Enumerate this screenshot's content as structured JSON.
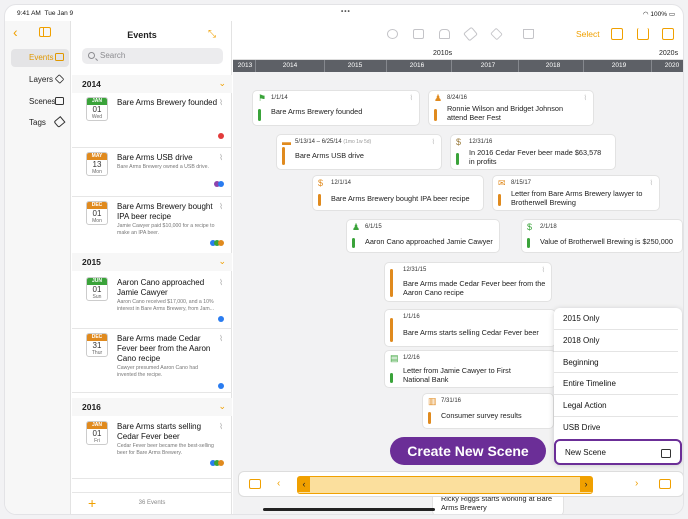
{
  "status": {
    "time": "9:41 AM",
    "date": "Tue Jan 9",
    "dots": "•••",
    "battery": "100%"
  },
  "nav": {
    "items": [
      {
        "label": "Events",
        "icon": "calendar-icon",
        "active": true
      },
      {
        "label": "Layers",
        "icon": "layers-icon"
      },
      {
        "label": "Scenes",
        "icon": "scenes-icon"
      },
      {
        "label": "Tags",
        "icon": "tag-icon"
      }
    ]
  },
  "list": {
    "title": "Events",
    "search_placeholder": "Search",
    "footer_count": "36 Events",
    "years": [
      "2014",
      "2015",
      "2016"
    ],
    "events": [
      {
        "month": "JAN",
        "day": "01",
        "weekday": "Wed",
        "month_color": "#3aa33a",
        "title": "Bare Arms Brewery founded",
        "desc": "",
        "dots": [
          "#e23b3b"
        ]
      },
      {
        "month": "MAY",
        "day": "13",
        "weekday": "Mon",
        "month_color": "#e08a1e",
        "title": "Bare Arms USB drive",
        "desc": "Bare Arms Brewery owned a USB drive.",
        "dots": [
          "#8e44ad",
          "#2a7cf0"
        ]
      },
      {
        "month": "DEC",
        "day": "01",
        "weekday": "Mon",
        "month_color": "#e08a1e",
        "title": "Bare Arms Brewery bought IPA beer recipe",
        "desc": "Jamie Cawyer paid $10,000 for a recipe to make an IPA beer.",
        "dots": [
          "#2a7cf0",
          "#3aa33a",
          "#e08a1e"
        ]
      },
      {
        "month": "JUN",
        "day": "01",
        "weekday": "Sun",
        "month_color": "#3aa33a",
        "title": "Aaron Cano approached Jamie Cawyer",
        "desc": "Aaron Cano received $17,000, and a 10% interest in Bare Arms Brewery, from Jam...",
        "dots": [
          "#2a7cf0"
        ]
      },
      {
        "month": "DEC",
        "day": "31",
        "weekday": "Thur",
        "month_color": "#e08a1e",
        "title": "Bare Arms made Cedar Fever beer from the Aaron Cano recipe",
        "desc": "Cawyer presumed Aaron Cano had invented the recipe.",
        "dots": [
          "#2a7cf0"
        ]
      },
      {
        "month": "JAN",
        "day": "01",
        "weekday": "Fri",
        "month_color": "#e08a1e",
        "title": "Bare Arms starts selling Cedar Fever beer",
        "desc": "Cedar Fever beer became the best-selling beer for Bare Arms Brewery.",
        "dots": [
          "#2a7cf0",
          "#3aa33a",
          "#e08a1e"
        ]
      }
    ]
  },
  "toolbar": {
    "select_label": "Select"
  },
  "ruler": {
    "decade_1": "2010s",
    "decade_2": "2020s",
    "years": [
      "2013",
      "2014",
      "2015",
      "2016",
      "2017",
      "2018",
      "2019",
      "2020"
    ]
  },
  "cards": [
    {
      "date": "1/1/14",
      "title": "Bare Arms Brewery founded",
      "title2": "",
      "icon": "flag-icon",
      "icon_glyph": "⚑",
      "color": "#3aa33a"
    },
    {
      "date": "8/24/16",
      "title": "Ronnie Wilson and Bridget Johnson",
      "title2": "attend Beer Fest",
      "icon": "person-icon",
      "icon_glyph": "♟",
      "color": "#e08a1e"
    },
    {
      "date": "5/13/14 – 6/25/14",
      "date_extra": "(1mo 1w 5d)",
      "title": "Bare Arms USB drive",
      "title2": "",
      "icon": "usb-icon",
      "icon_glyph": "▬",
      "color": "#e08a1e"
    },
    {
      "date": "12/31/16",
      "title": "In 2016 Cedar Fever beer made $63,578",
      "title2": "in profits",
      "icon": "money-bag-icon",
      "icon_glyph": "$",
      "color": "#3aa33a"
    },
    {
      "date": "12/1/14",
      "title": "Bare Arms Brewery bought IPA beer recipe",
      "title2": "",
      "icon": "dollar-icon",
      "icon_glyph": "$",
      "color": "#e08a1e"
    },
    {
      "date": "8/15/17",
      "title": "Letter from Bare Arms Brewery lawyer to",
      "title2": "Brotherwell Brewing",
      "icon": "envelope-icon",
      "icon_glyph": "✉",
      "color": "#e08a1e"
    },
    {
      "date": "6/1/15",
      "title": "Aaron Cano approached Jamie Cawyer",
      "title2": "",
      "icon": "people-icon",
      "icon_glyph": "♟",
      "color": "#3aa33a"
    },
    {
      "date": "2/1/18",
      "title": "Value of Brotherwell Brewing is $250,000",
      "title2": "",
      "icon": "dollar-icon",
      "icon_glyph": "$",
      "color": "#3aa33a"
    },
    {
      "date": "12/31/15",
      "title": "Bare Arms made Cedar Fever beer from the",
      "title2": "Aaron Cano recipe",
      "icon": "",
      "icon_glyph": "",
      "color": "#e08a1e"
    },
    {
      "date": "1/1/16",
      "title": "Bare Arms starts selling Cedar Fever beer",
      "title2": "",
      "icon": "",
      "icon_glyph": "",
      "color": "#e08a1e"
    },
    {
      "date": "1/2/16",
      "title": "Letter from Jamie Cawyer to First",
      "title2": "National Bank",
      "icon": "document-icon",
      "icon_glyph": "▤",
      "color": "#3aa33a"
    },
    {
      "date": "7/31/16",
      "title": "Consumer survey results",
      "title2": "",
      "icon": "clipboard-icon",
      "icon_glyph": "▥",
      "color": "#e08a1e"
    },
    {
      "date": "",
      "title": "Ricky Riggs starts working at Bare",
      "title2": "Arms Brewery",
      "icon": "",
      "icon_glyph": "",
      "color": "#e08a1e"
    }
  ],
  "popover": {
    "options": [
      "2015 Only",
      "2018 Only",
      "Beginning",
      "Entire Timeline",
      "Legal Action",
      "USB Drive"
    ],
    "new_scene": "New Scene"
  },
  "callout": {
    "label": "Create New Scene"
  },
  "bottom": {
    "left_arrow": "‹",
    "right_arrow": "›",
    "handle_left": "‹",
    "handle_right": "›"
  }
}
